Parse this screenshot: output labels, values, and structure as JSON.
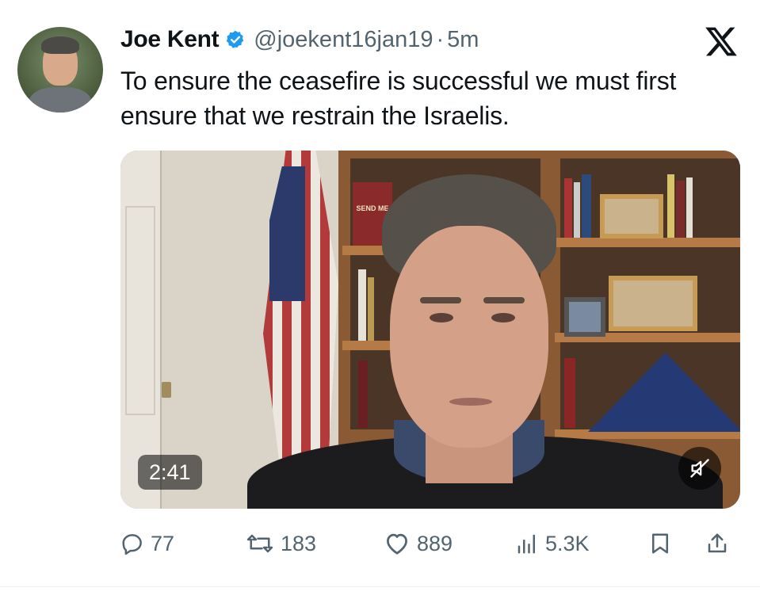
{
  "tweet": {
    "author_name": "Joe Kent",
    "handle": "@joekent16jan19",
    "separator": "·",
    "time_ago": "5m",
    "verified_icon": "verified-badge-icon",
    "text": "To ensure the ceasefire is successful we must first ensure that we restrain the Israelis.",
    "video": {
      "duration": "2:41",
      "book_title": "SEND ME",
      "muted": true
    },
    "actions": {
      "replies": "77",
      "reposts": "183",
      "likes": "889",
      "views": "5.3K"
    }
  },
  "colors": {
    "verified": "#1d9bf0",
    "secondary_text": "#536471",
    "primary_text": "#0f1419"
  }
}
